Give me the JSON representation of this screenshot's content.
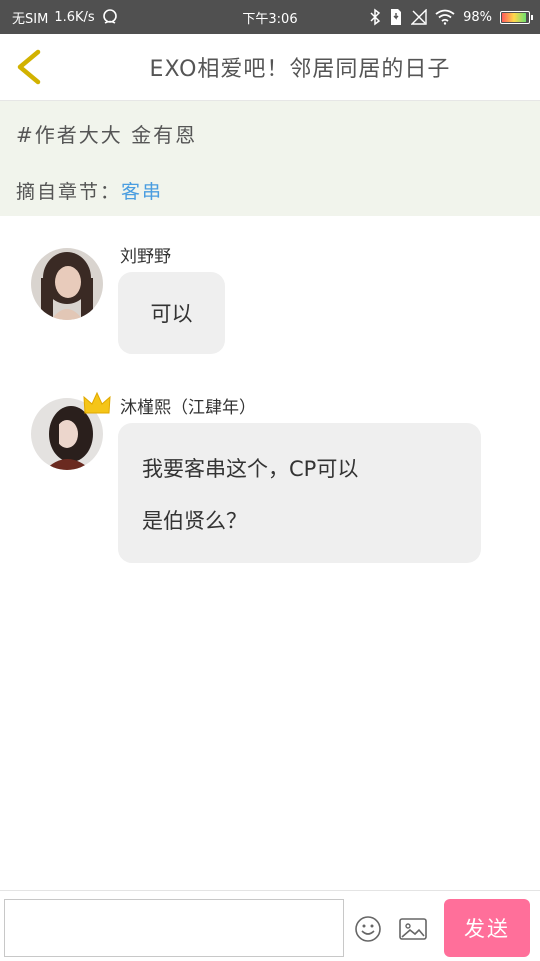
{
  "status_bar": {
    "carrier": "无SIM",
    "speed": "1.6K/s",
    "time": "下午3:06",
    "battery": "98%"
  },
  "header": {
    "title": "EXO相爱吧！邻居同居的日子"
  },
  "info": {
    "author": "#作者大大 金有恩",
    "chapter_label": "摘自章节：",
    "chapter_link": "客串"
  },
  "messages": [
    {
      "name": "刘野野",
      "text": "可以"
    },
    {
      "name": "沐槿熙（江肆年）",
      "text_line1": "我要客串这个，CP可以",
      "text_line2": "是伯贤么？"
    }
  ],
  "composer": {
    "send_label": "发送"
  },
  "colors": {
    "accent": "#ff6f9a",
    "link": "#4a9de0",
    "back_icon": "#d2b200",
    "info_bg": "#f1f4ec"
  }
}
